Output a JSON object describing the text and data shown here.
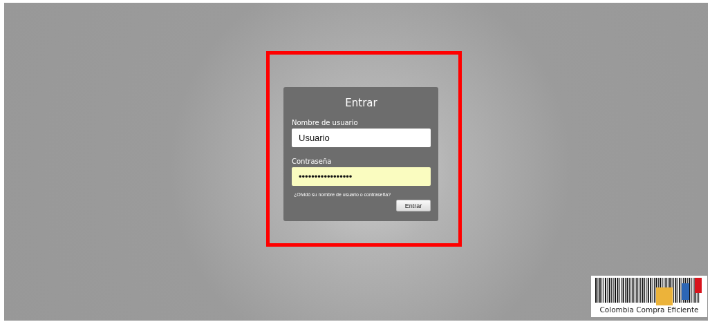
{
  "login": {
    "title": "Entrar",
    "username": {
      "label": "Nombre de usuario",
      "value": "Usuario"
    },
    "password": {
      "label": "Contraseña",
      "value": "•••••••••••••••••",
      "autofilled": true
    },
    "forgot_link": "¿Olvidó su nombre de usuario o contraseña?",
    "submit": "Entrar"
  },
  "highlight": {
    "color": "#ff0000"
  },
  "logo": {
    "text": "Colombia Compra Eficiente"
  }
}
